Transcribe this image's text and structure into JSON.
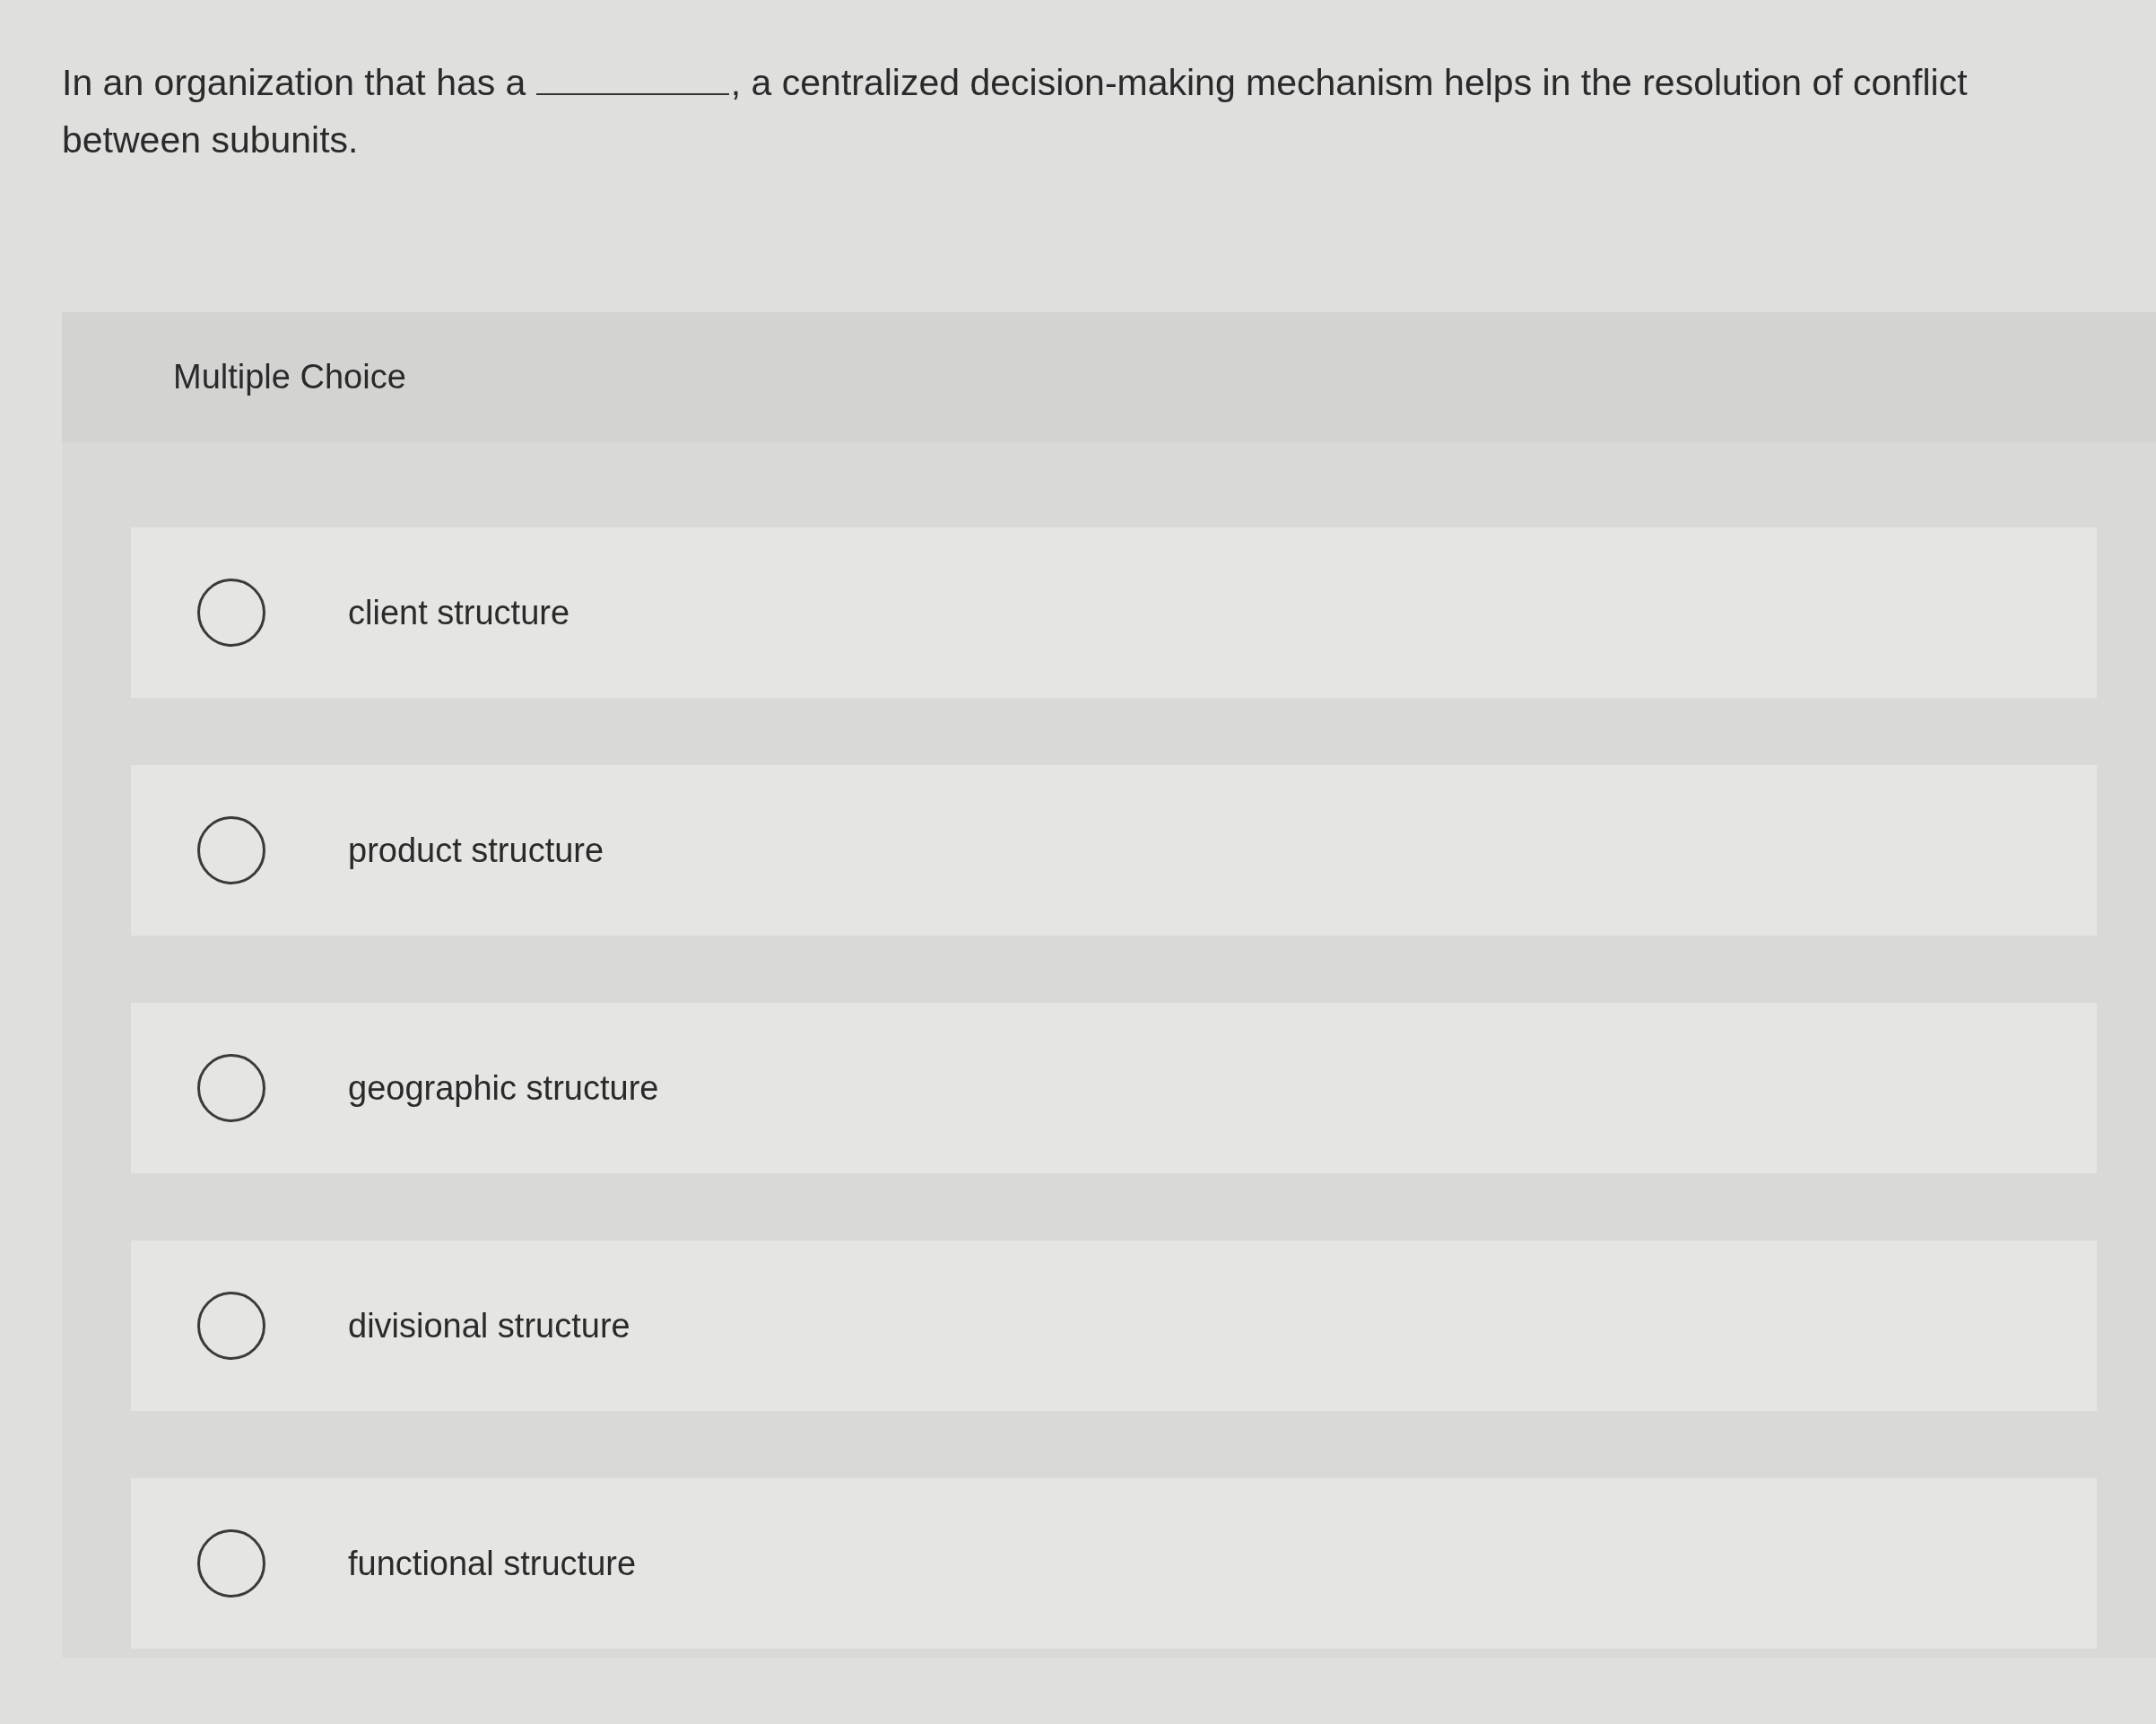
{
  "question": {
    "before": "In an organization that has a",
    "after": ", a centralized decision-making mechanism helps in the resolution of conflict between subunits."
  },
  "answer_type": "Multiple Choice",
  "options": [
    {
      "label": "client structure",
      "selected": false
    },
    {
      "label": "product structure",
      "selected": false
    },
    {
      "label": "geographic structure",
      "selected": false
    },
    {
      "label": "divisional structure",
      "selected": false
    },
    {
      "label": "functional structure",
      "selected": false
    }
  ]
}
